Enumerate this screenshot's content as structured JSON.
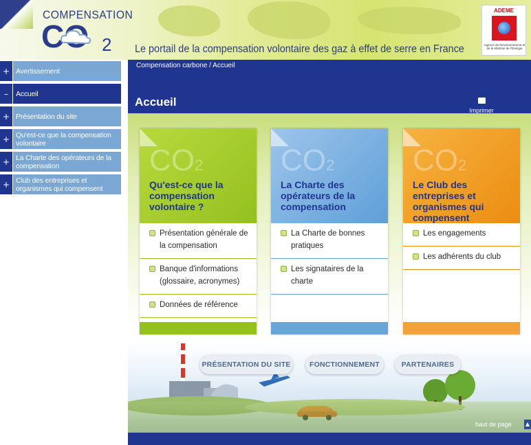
{
  "header": {
    "logo_word": "COMPENSATION",
    "logo_co": "CO",
    "logo_two": "2",
    "tagline": "Le portail de la compensation volontaire des gaz à effet de serre en France",
    "ademe_label": "ADEME",
    "ademe_sub": "Agence de l'Environnement et de la Maîtrise de l'Energie"
  },
  "sidebar": {
    "items": [
      {
        "sign": "+",
        "label": "Avertissement"
      },
      {
        "sign": "–",
        "label": "Accueil"
      },
      {
        "sign": "+",
        "label": "Présentation du site"
      },
      {
        "sign": "+",
        "label": "Qu'est-ce que la compensation volontaire"
      },
      {
        "sign": "+",
        "label": "La Charte des opérateurs de la compensation"
      },
      {
        "sign": "+",
        "label": "Club des entreprises et organismes qui compensent"
      }
    ]
  },
  "main": {
    "breadcrumb": "Compensation carbone / Accueil",
    "title": "Accueil",
    "print_label": "Imprimer"
  },
  "cards": [
    {
      "co2": "CO",
      "co2_sub": "2",
      "title": "Qu'est-ce que la compensation volontaire ?",
      "links": [
        "Présentation générale de la compensation",
        "Banque d'informations (glossaire, acronymes)",
        "Données de référence"
      ]
    },
    {
      "co2": "CO",
      "co2_sub": "2",
      "title": "La Charte des opérateurs de la compensation",
      "links": [
        "La Charte de bonnes pratiques",
        "Les signataires de la charte"
      ]
    },
    {
      "co2": "CO",
      "co2_sub": "2",
      "title": "Le Club des entreprises et organismes qui compensent",
      "links": [
        "Les engagements",
        "Les adhérents du club"
      ]
    }
  ],
  "scene": {
    "buttons": [
      "PRÉSENTATION DU SITE",
      "FONCTIONNEMENT",
      "PARTENAIRES"
    ],
    "top_link": "haut de page",
    "top_arrow": "▲"
  },
  "colors": {
    "navy": "#1f3590",
    "nav_light": "#7ba7d4",
    "green": "#94c11f",
    "blue": "#5f9fd8",
    "orange": "#ec8d12"
  }
}
